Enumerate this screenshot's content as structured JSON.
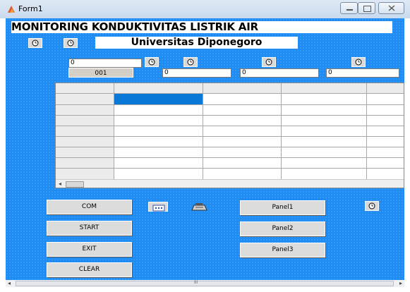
{
  "window": {
    "title": "Form1"
  },
  "banner": {
    "text": "MONITORING KONDUKTIVITAS LISTRIK AIR"
  },
  "subtitle": {
    "text": "Universitas Diponegoro"
  },
  "inputs": {
    "main": "0",
    "ch1": "0",
    "ch2": "0",
    "ch3": "0"
  },
  "counter": {
    "text": "001"
  },
  "buttons": {
    "com": "COM",
    "start": "START",
    "exit": "EXIT",
    "clear": "CLEAR",
    "panel1": "Panel1",
    "panel2": "Panel2",
    "panel3": "Panel3"
  },
  "scrollbar": {
    "grip": "III",
    "left": "◂",
    "right": "▸"
  },
  "colors": {
    "form_bg": "#1e8cf3",
    "selected_cell": "#0a78d7"
  }
}
